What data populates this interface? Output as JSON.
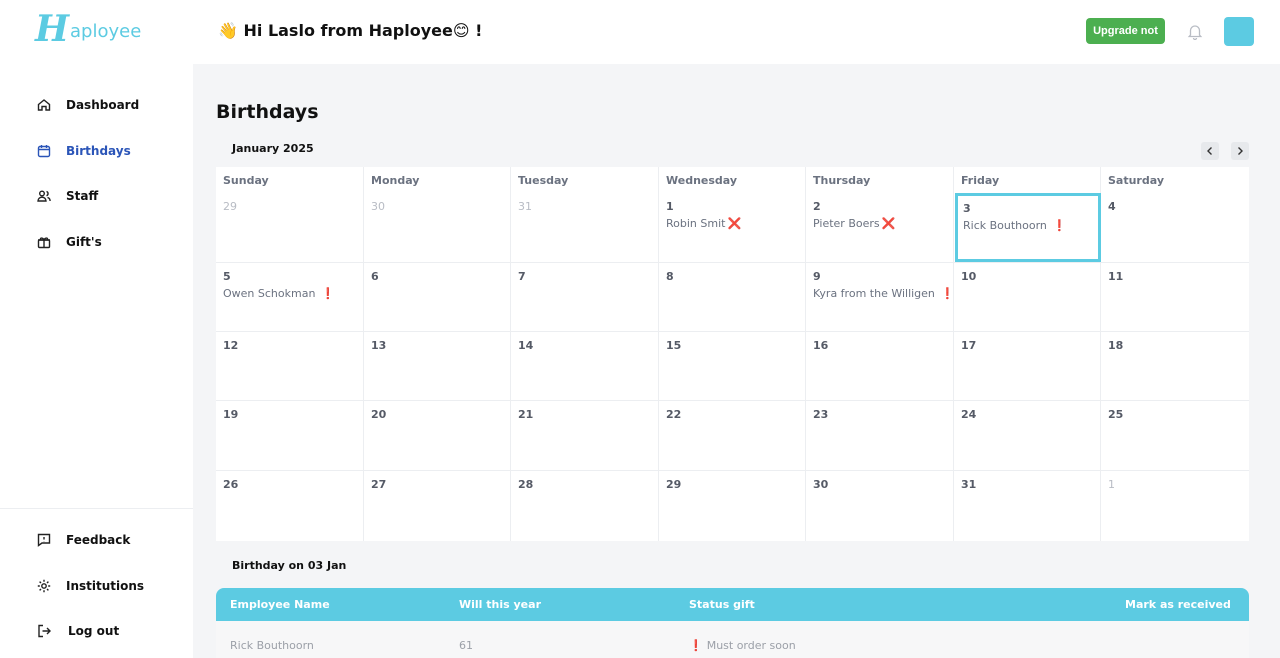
{
  "brand": {
    "logo_letter": "H",
    "logo_rest": "aployee"
  },
  "header": {
    "greeting": "👋 Hi Laslo from Haployee😊 !",
    "upgrade_label": "Upgrade not"
  },
  "sidebar": {
    "items": [
      {
        "label": "Dashboard",
        "icon": "home-icon"
      },
      {
        "label": "Birthdays",
        "icon": "calendar-icon",
        "active": true
      },
      {
        "label": "Staff",
        "icon": "staff-icon"
      },
      {
        "label": "Gift's",
        "icon": "gift-icon"
      }
    ],
    "bottom_items": [
      {
        "label": "Feedback",
        "icon": "feedback-icon"
      },
      {
        "label": "Institutions",
        "icon": "gear-icon"
      },
      {
        "label": "Log out",
        "icon": "logout-icon"
      }
    ]
  },
  "main": {
    "title": "Birthdays",
    "month_label": "January 2025"
  },
  "calendar": {
    "day_names": [
      "Sunday",
      "Monday",
      "Tuesday",
      "Wednesday",
      "Thursday",
      "Friday",
      "Saturday"
    ],
    "weeks": [
      [
        {
          "day": "29",
          "muted": true
        },
        {
          "day": "30",
          "muted": true
        },
        {
          "day": "31",
          "muted": true
        },
        {
          "day": "1",
          "event": "Robin Smit",
          "mark": "❌"
        },
        {
          "day": "2",
          "event": "Pieter Boers",
          "mark": "❌"
        },
        {
          "day": "3",
          "event": "Rick Bouthoorn",
          "mark": "❗",
          "selected": true
        },
        {
          "day": "4"
        }
      ],
      [
        {
          "day": "5",
          "event": "Owen Schokman",
          "mark": "❗"
        },
        {
          "day": "6"
        },
        {
          "day": "7"
        },
        {
          "day": "8"
        },
        {
          "day": "9",
          "event": "Kyra from the Willigen",
          "mark": "❗"
        },
        {
          "day": "10"
        },
        {
          "day": "11"
        }
      ],
      [
        {
          "day": "12"
        },
        {
          "day": "13"
        },
        {
          "day": "14"
        },
        {
          "day": "15"
        },
        {
          "day": "16"
        },
        {
          "day": "17"
        },
        {
          "day": "18"
        }
      ],
      [
        {
          "day": "19"
        },
        {
          "day": "20"
        },
        {
          "day": "21"
        },
        {
          "day": "22"
        },
        {
          "day": "23"
        },
        {
          "day": "24"
        },
        {
          "day": "25"
        }
      ],
      [
        {
          "day": "26"
        },
        {
          "day": "27"
        },
        {
          "day": "28"
        },
        {
          "day": "29"
        },
        {
          "day": "30"
        },
        {
          "day": "31"
        },
        {
          "day": "1",
          "muted": true
        }
      ]
    ]
  },
  "birthday_table": {
    "title": "Birthday on 03 Jan",
    "columns": [
      "Employee Name",
      "Will this year",
      "Status gift",
      "Mark as received"
    ],
    "rows": [
      {
        "name": "Rick Bouthoorn",
        "age": "61",
        "status_mark": "❗",
        "status": "Must order soon"
      }
    ]
  },
  "colors": {
    "accent": "#5ccbe2",
    "upgrade": "#4caf50",
    "active_nav": "#2b55b8",
    "alert": "#e53935"
  }
}
